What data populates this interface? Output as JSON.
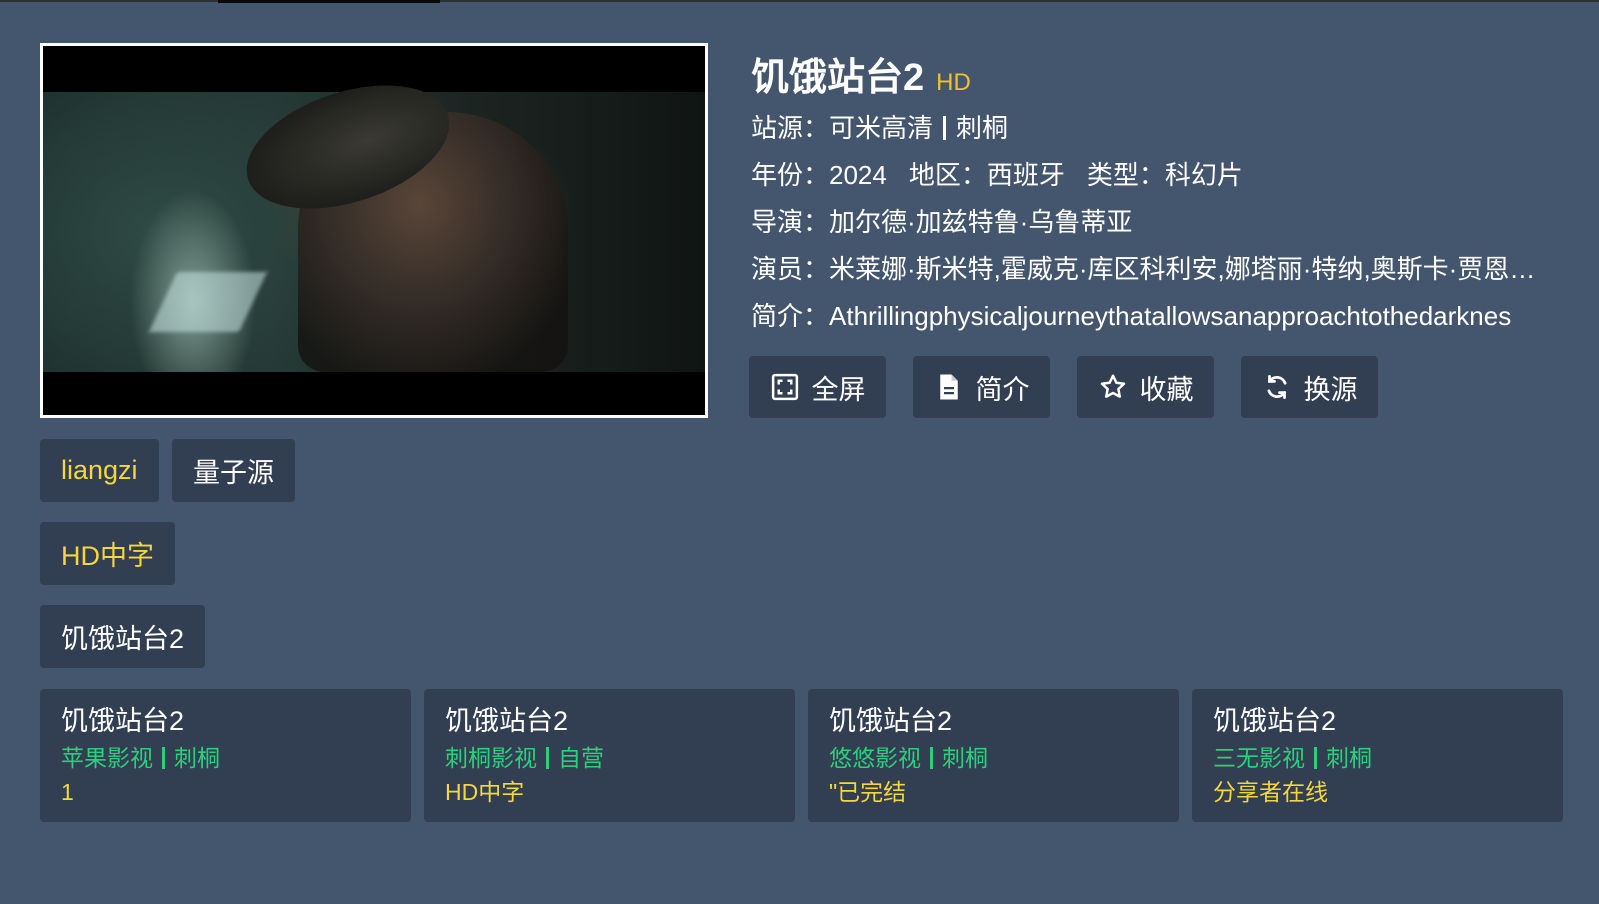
{
  "movie": {
    "title": "饥饿站台2",
    "quality": "HD",
    "source_label": "站源：",
    "source_site": "可米高清",
    "source_owner": "刺桐",
    "year_label": "年份：",
    "year": "2024",
    "region_label": "地区：",
    "region": "西班牙",
    "genre_label": "类型：",
    "genre": "科幻片",
    "director_label": "导演：",
    "director": "加尔德·加兹特鲁·乌鲁蒂亚",
    "cast_label": "演员：",
    "cast": "米莱娜·斯米特,霍威克·库区科利安,娜塔丽·特纳,奥斯卡·贾恩…",
    "intro_label": "简介：",
    "intro": "Athrillingphysicaljourneythatallowsanapproachtothedarknes"
  },
  "actions": [
    {
      "label": "全屏",
      "icon": "fullscreen-icon"
    },
    {
      "label": "简介",
      "icon": "document-icon"
    },
    {
      "label": "收藏",
      "icon": "star-icon"
    },
    {
      "label": "换源",
      "icon": "refresh-icon"
    }
  ],
  "source_tabs": {
    "active": "liangzi",
    "name": "量子源"
  },
  "episode_group": "HD中字",
  "episode": "饥饿站台2",
  "other_sources": [
    {
      "title": "饥饿站台2",
      "site": "苹果影视",
      "owner": "刺桐",
      "note": "1"
    },
    {
      "title": "饥饿站台2",
      "site": "刺桐影视",
      "owner": "自营",
      "note": "HD中字"
    },
    {
      "title": "饥饿站台2",
      "site": "悠悠影视",
      "owner": "刺桐",
      "note": "\"已完结"
    },
    {
      "title": "饥饿站台2",
      "site": "三无影视",
      "owner": "刺桐",
      "note": "分享者在线"
    }
  ],
  "colors": {
    "background": "#44556e",
    "panel": "#323f53",
    "accent_yellow": "#f4d63e",
    "accent_green": "#2bd07a",
    "hd_gold": "#f1c12c"
  }
}
